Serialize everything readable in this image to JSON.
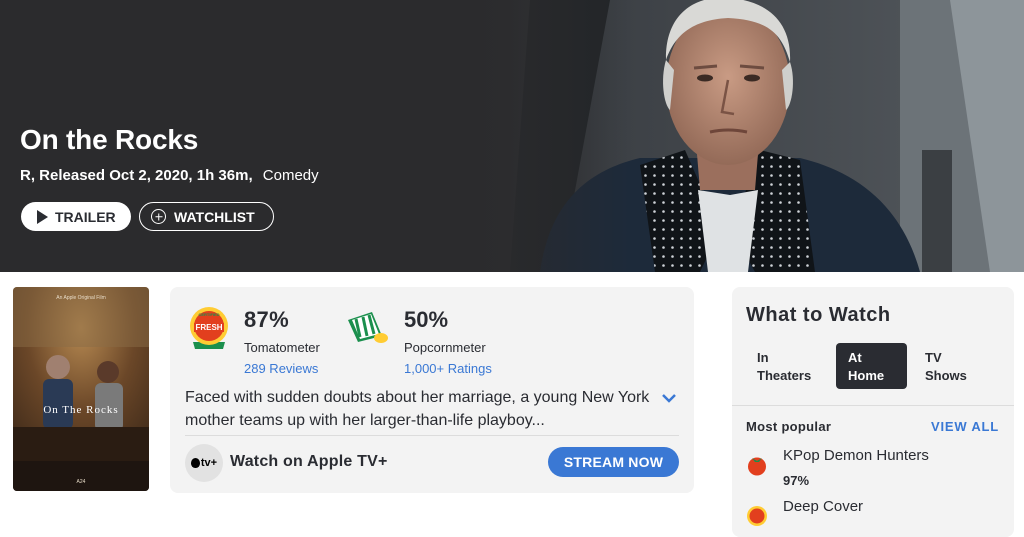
{
  "hero": {
    "title": "On the Rocks",
    "meta_info": "R, Released Oct 2, 2020, 1h 36m,",
    "genre": "Comedy",
    "trailer_label": "TRAILER",
    "watchlist_label": "WATCHLIST"
  },
  "poster": {
    "title_text": "On The Rocks"
  },
  "scores": {
    "tomatometer": {
      "value": "87%",
      "label": "Tomatometer",
      "count": "289 Reviews",
      "badge": "certified-fresh-icon"
    },
    "popcornmeter": {
      "value": "50%",
      "label": "Popcornmeter",
      "count": "1,000+ Ratings",
      "badge": "popcorn-bucket-icon"
    }
  },
  "synopsis": "Faced with sudden doubts about her marriage, a young New York mother teams up with her larger-than-life playboy...",
  "streaming": {
    "provider_badge": "tv+",
    "watch_text": "Watch on Apple TV+",
    "button_label": "STREAM NOW"
  },
  "what_to_watch": {
    "title": "What to Watch",
    "tabs": [
      {
        "label_line1": "In",
        "label_line2": "Theaters",
        "active": false
      },
      {
        "label_line1": "At",
        "label_line2": "Home",
        "active": true
      },
      {
        "label_line1": "TV",
        "label_line2": "Shows",
        "active": false
      }
    ],
    "section_label": "Most popular",
    "view_all": "VIEW ALL",
    "items": [
      {
        "title": "KPop Demon Hunters",
        "score": "97%",
        "icon": "fresh-tomato-icon"
      },
      {
        "title": "Deep Cover",
        "score": "",
        "icon": "certified-fresh-icon"
      }
    ]
  },
  "colors": {
    "hero_bg": "#2b2b2d",
    "accent_blue": "#3a78d4",
    "card_bg": "#f3f3f3",
    "text_dark": "#2a2c32",
    "tomato_red": "#e23f1e",
    "popcorn_green": "#1b8f4d"
  }
}
